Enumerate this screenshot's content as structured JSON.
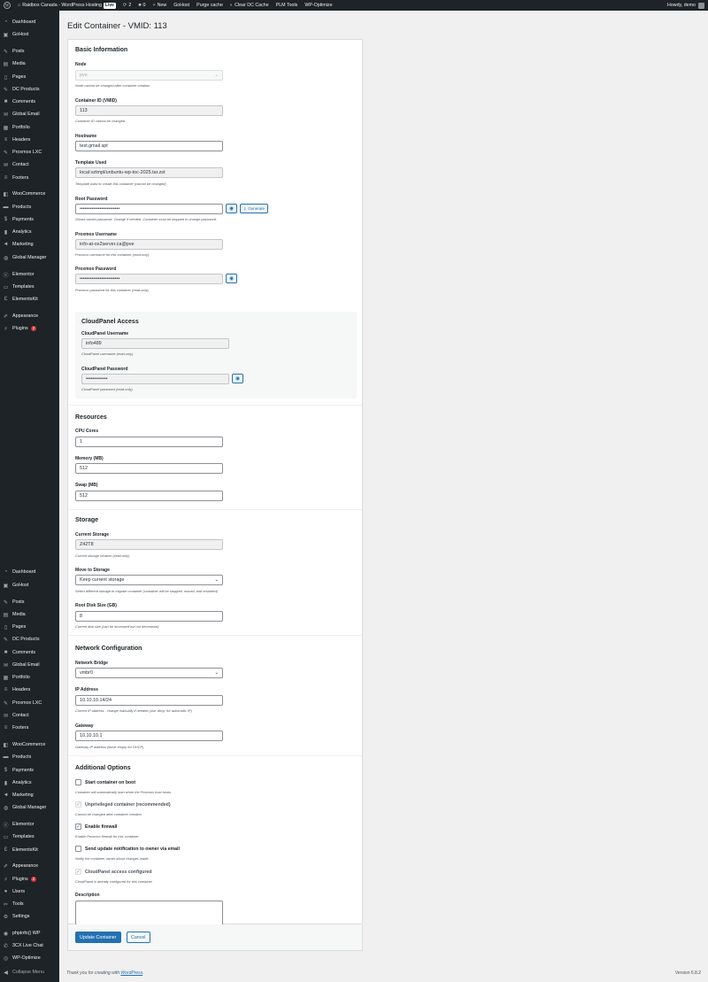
{
  "adminbar": {
    "site_name": "Raidbox Canada - WordPress Hosting",
    "live_badge": "Live",
    "updates_count": "2",
    "comments_count": "0",
    "new_label": "New",
    "links": [
      "GoHost",
      "Purge cache",
      "Clear DC Cache",
      "PLM Tools",
      "WP-Optimize"
    ],
    "howdy": "Howdy, demo"
  },
  "sidebar": {
    "items": [
      {
        "label": "Dashboard",
        "icon": "dashboard-icon"
      },
      {
        "label": "GoHost",
        "icon": "gohost-icon"
      },
      {
        "label": "Posts",
        "icon": "pin-icon"
      },
      {
        "label": "Media",
        "icon": "media-icon"
      },
      {
        "label": "Pages",
        "icon": "page-icon"
      },
      {
        "label": "DC Products",
        "icon": "pin-icon"
      },
      {
        "label": "Comments",
        "icon": "comment-icon"
      },
      {
        "label": "Global Email",
        "icon": "email-icon"
      },
      {
        "label": "Portfolio",
        "icon": "portfolio-icon"
      },
      {
        "label": "Headers",
        "icon": "list-icon"
      },
      {
        "label": "Proxmox LXC",
        "icon": "pin-icon"
      },
      {
        "label": "Contact",
        "icon": "email-icon"
      },
      {
        "label": "Footers",
        "icon": "list-icon"
      },
      {
        "label": "WooCommerce",
        "icon": "woo-icon"
      },
      {
        "label": "Products",
        "icon": "archive-icon"
      },
      {
        "label": "Payments",
        "icon": "dollar-icon"
      },
      {
        "label": "Analytics",
        "icon": "chart-icon"
      },
      {
        "label": "Marketing",
        "icon": "megaphone-icon"
      },
      {
        "label": "Global Manager",
        "icon": "globe-icon"
      },
      {
        "label": "Elementor",
        "icon": "elementor-icon"
      },
      {
        "label": "Templates",
        "icon": "folder-icon"
      },
      {
        "label": "ElementsKit",
        "icon": "ek-icon"
      },
      {
        "label": "Appearance",
        "icon": "brush-icon"
      },
      {
        "label": "Plugins",
        "icon": "plugin-icon",
        "badge": "2"
      }
    ],
    "bottom_items": [
      {
        "label": "Dashboard",
        "icon": "dashboard-icon"
      },
      {
        "label": "GoHost",
        "icon": "gohost-icon"
      },
      {
        "label": "Posts",
        "icon": "pin-icon"
      },
      {
        "label": "Media",
        "icon": "media-icon"
      },
      {
        "label": "Pages",
        "icon": "page-icon"
      },
      {
        "label": "DC Products",
        "icon": "pin-icon"
      },
      {
        "label": "Comments",
        "icon": "comment-icon"
      },
      {
        "label": "Global Email",
        "icon": "email-icon"
      },
      {
        "label": "Portfolio",
        "icon": "portfolio-icon"
      },
      {
        "label": "Headers",
        "icon": "list-icon"
      },
      {
        "label": "Proxmox LXC",
        "icon": "pin-icon"
      },
      {
        "label": "Contact",
        "icon": "email-icon"
      },
      {
        "label": "Footers",
        "icon": "list-icon"
      },
      {
        "label": "WooCommerce",
        "icon": "woo-icon"
      },
      {
        "label": "Products",
        "icon": "archive-icon"
      },
      {
        "label": "Payments",
        "icon": "dollar-icon"
      },
      {
        "label": "Analytics",
        "icon": "chart-icon"
      },
      {
        "label": "Marketing",
        "icon": "megaphone-icon"
      },
      {
        "label": "Global Manager",
        "icon": "globe-icon"
      },
      {
        "label": "Elementor",
        "icon": "elementor-icon"
      },
      {
        "label": "Templates",
        "icon": "folder-icon"
      },
      {
        "label": "ElementsKit",
        "icon": "ek-icon"
      },
      {
        "label": "Appearance",
        "icon": "brush-icon"
      },
      {
        "label": "Plugins",
        "icon": "plugin-icon",
        "badge": "2"
      },
      {
        "label": "Users",
        "icon": "users-icon"
      },
      {
        "label": "Tools",
        "icon": "tools-icon"
      },
      {
        "label": "Settings",
        "icon": "settings-icon"
      },
      {
        "label": "phpinfo() WP",
        "icon": "info-icon"
      },
      {
        "label": "3CX Live Chat",
        "icon": "chat-icon"
      },
      {
        "label": "WP-Optimize",
        "icon": "optimize-icon"
      },
      {
        "label": "Collapse Menu",
        "icon": "collapse-icon"
      }
    ]
  },
  "page": {
    "title": "Edit Container - VMID: 113"
  },
  "basic": {
    "title": "Basic Information",
    "node_label": "Node",
    "node_value": "pve",
    "node_help": "Node cannot be changed after container creation",
    "vmid_label": "Container ID (VMID)",
    "vmid_value": "113",
    "vmid_help": "Container ID cannot be changed",
    "hostname_label": "Hostname",
    "hostname_value": "test.gmail.spt",
    "template_label": "Template Used",
    "template_value": "local:vztmpl/unbuntu-wp-toc-2025.tar.zst",
    "template_help": "Template used to create this container (cannot be changed)",
    "rootpw_label": "Root Password",
    "rootpw_value": "••••••••••••••••••••••••",
    "generate_label": "Generate",
    "rootpw_help": "Shows stored password. Change if needed. Container must be stopped to change password.",
    "pxuser_label": "Proxmox Username",
    "pxuser_value": "info-at-ox2server.ca@pve",
    "pxuser_help": "Proxmox username for this container (read-only)",
    "pxpw_label": "Proxmox Password",
    "pxpw_value": "••••••••••••••••••••••••",
    "pxpw_help": "Proxmox password for this container (read-only)"
  },
  "cloudpanel": {
    "title": "CloudPanel Access",
    "user_label": "CloudPanel Username",
    "user_value": "info489",
    "user_help": "CloudPanel username (read-only)",
    "pw_label": "CloudPanel Password",
    "pw_value": "•••••••••••••",
    "pw_help": "CloudPanel password (read-only)"
  },
  "resources": {
    "title": "Resources",
    "cpu_label": "CPU Cores",
    "cpu_value": "1",
    "mem_label": "Memory (MB)",
    "mem_value": "512",
    "swap_label": "Swap (MB)",
    "swap_value": "512"
  },
  "storage": {
    "title": "Storage",
    "current_label": "Current Storage",
    "current_value": "Z42T8",
    "current_help": "Current storage location (read-only)",
    "move_label": "Move to Storage",
    "move_value": "Keep current storage",
    "move_help": "Select different storage to migrate container (container will be stopped, moved, and restarted)",
    "disk_label": "Root Disk Size (GB)",
    "disk_value": "8",
    "disk_help": "Current disk size (can be increased but not decreased)"
  },
  "network": {
    "title": "Network Configuration",
    "bridge_label": "Network Bridge",
    "bridge_value": "vmbr0",
    "ip_label": "IP Address",
    "ip_value": "10.10.10.14/24",
    "ip_help": "Current IP address - change manually if needed (use 'dhcp' for automatic IP)",
    "gw_label": "Gateway",
    "gw_value": "10.10.10.1",
    "gw_help": "Gateway IP address (leave empty for DHCP)"
  },
  "options": {
    "title": "Additional Options",
    "start_label": "Start container on boot",
    "start_help": "Container will automatically start when the Proxmox host boots",
    "unpriv_label": "Unprivileged container (recommended)",
    "unpriv_help": "Cannot be changed after container creation",
    "firewall_label": "Enable firewall",
    "firewall_help": "Enable Proxmox firewall for this container",
    "notify_label": "Send update notification to owner via email",
    "notify_help": "Notify the container owner about changes made",
    "cp_label": "CloudPanel access configured",
    "cp_help": "CloudPanel is already configured for this container",
    "desc_label": "Description",
    "desc_value": ""
  },
  "actions": {
    "update_label": "Update Container",
    "cancel_label": "Cancel"
  },
  "footer": {
    "thanks_prefix": "Thank you for creating with",
    "wp_link": "WordPress",
    "version": "Version 6.8.2"
  },
  "colors": {
    "primary": "#2271b1",
    "sidebar_bg": "#1d2327",
    "badge": "#d63638"
  }
}
